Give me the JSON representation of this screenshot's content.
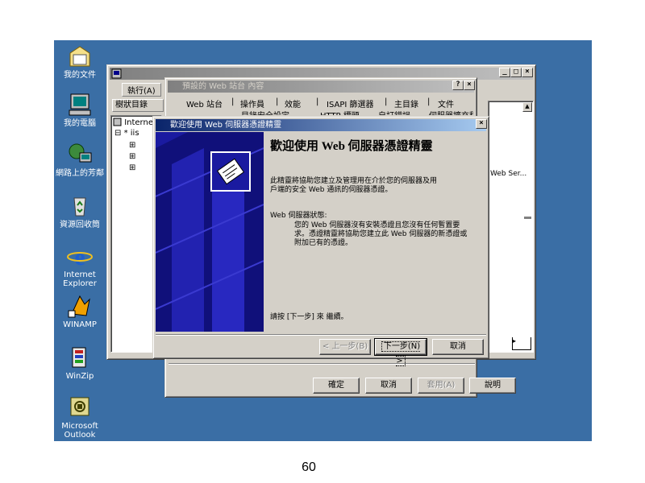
{
  "desktop_icons": [
    {
      "label": "我的文件",
      "icon": "folder-documents-icon"
    },
    {
      "label": "我的電腦",
      "icon": "my-computer-icon"
    },
    {
      "label": "網路上的芳鄰",
      "icon": "network-icon"
    },
    {
      "label": "資源回收筒",
      "icon": "recycle-bin-icon"
    },
    {
      "label": "Internet Explorer",
      "icon": "internet-explorer-icon"
    },
    {
      "label": "WINAMP",
      "icon": "winamp-icon"
    },
    {
      "label": "WinZip",
      "icon": "winzip-icon"
    },
    {
      "label": "Microsoft Outlook",
      "icon": "outlook-icon"
    }
  ],
  "iis_window": {
    "menu": {
      "action": "執行(A)",
      "view_prefix": "檢"
    },
    "tree_header": "樹狀目錄",
    "tree_root": "Internet",
    "tree_node": "* iis"
  },
  "props_dialog": {
    "title": "預設的 Web 站台 內容",
    "help_btn": "?",
    "close_btn": "×",
    "tabs": [
      "Web 站台",
      "操作員",
      "效能",
      "ISAPI 篩選器",
      "主目錄",
      "文件"
    ],
    "tabs_row2": [
      "目錄安全設定",
      "HTTP 標頭",
      "自訂錯誤",
      "伺服器擴充程式"
    ],
    "buttons": {
      "ok": "確定",
      "cancel": "取消",
      "apply": "套用(A)",
      "help": "說明"
    }
  },
  "right_pane": {
    "item": "Web Ser..."
  },
  "wizard": {
    "title": "歡迎使用 Web 伺服器憑證精靈",
    "heading": "歡迎使用 Web 伺服器憑證精靈",
    "intro": "此精靈將協助您建立及管理用在介於您的伺服器及用戶端的安全 Web 通訊的伺服器憑證。",
    "status_label": "Web 伺服器狀態:",
    "status_text": "您的 Web 伺服器沒有安裝憑證且您沒有任何暫置要求。憑證精靈將協助您建立此 Web 伺服器的新憑證或附加已有的憑證。",
    "continue_text": "請按 [下一步] 來 繼續。",
    "buttons": {
      "back": "< 上一步(B)",
      "next": "下一步(N) >",
      "cancel": "取消"
    }
  },
  "page_number": "60",
  "colors": {
    "desktop": "#3a6ea5",
    "title_active": "#0a246a",
    "wizard_banner": "#1a1aa0"
  }
}
